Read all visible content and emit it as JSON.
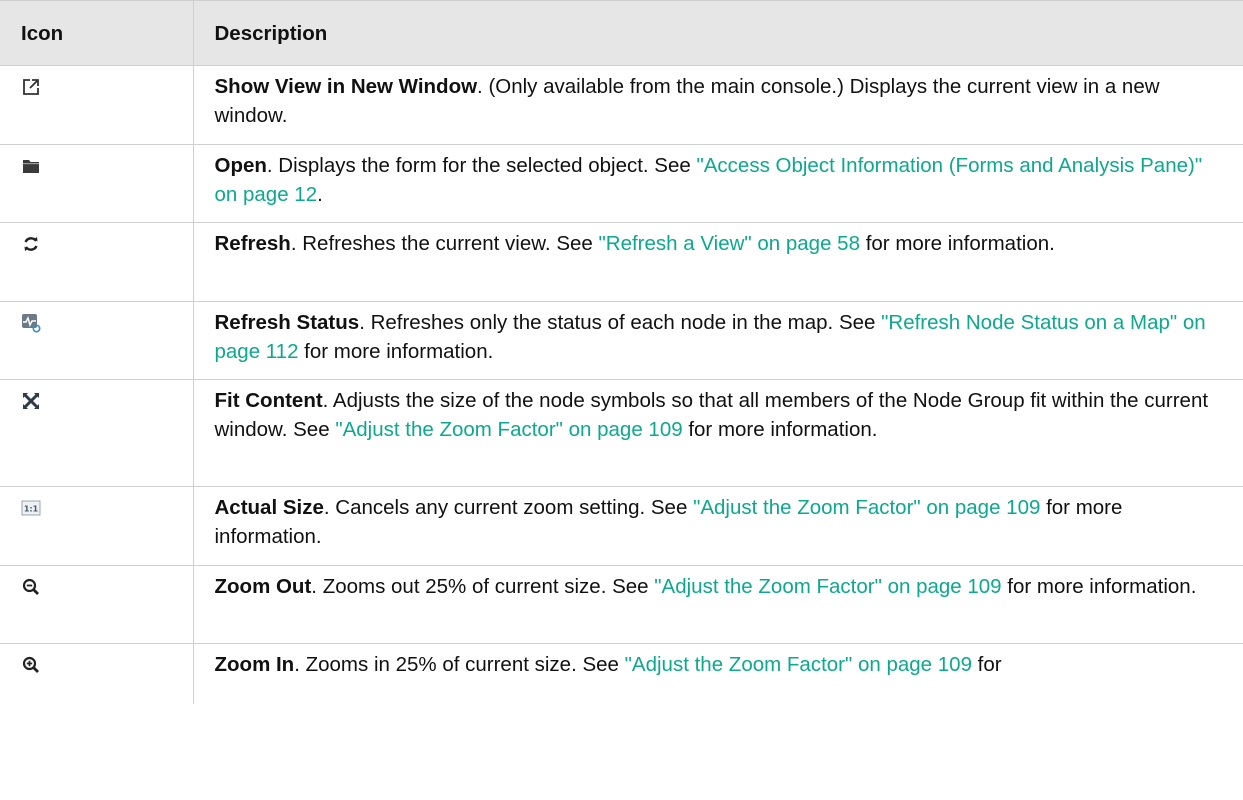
{
  "header": {
    "icon": "Icon",
    "description": "Description"
  },
  "rows": [
    {
      "icon": "new-window-icon",
      "title": "Show View in New Window",
      "pre": ". (Only available from the main console.) Displays the current view in a new window.",
      "link": "",
      "post": ""
    },
    {
      "icon": "folder-icon",
      "title": "Open",
      "pre": ". Displays the form for the selected object. See ",
      "link": "\"Access Object Information (Forms and Analysis Pane)\" on page 12",
      "post": "."
    },
    {
      "icon": "refresh-icon",
      "title": "Refresh",
      "pre": ". Refreshes the current view. See ",
      "link": "\"Refresh a View\" on page 58",
      "post": " for more information."
    },
    {
      "icon": "refresh-status-icon",
      "title": "Refresh Status",
      "pre": ". Refreshes only the status of each node in the map. See ",
      "link": "\"Refresh Node Status on a Map\" on page 112",
      "post": " for more information."
    },
    {
      "icon": "fit-content-icon",
      "title": "Fit Content",
      "pre": ". Adjusts the size of the node symbols so that all members of the Node Group fit within the current window. See ",
      "link": "\"Adjust the Zoom Factor\" on page 109",
      "post": " for more information."
    },
    {
      "icon": "actual-size-icon",
      "icon_text": "1:1",
      "title": "Actual Size",
      "pre": ". Cancels any current zoom setting. See ",
      "link": "\"Adjust the Zoom Factor\" on page 109",
      "post": " for more information."
    },
    {
      "icon": "zoom-out-icon",
      "title": "Zoom Out",
      "pre": ". Zooms out 25% of current size. See ",
      "link": "\"Adjust the Zoom Factor\" on page 109",
      "post": " for more information."
    },
    {
      "icon": "zoom-in-icon",
      "title": "Zoom In",
      "pre": ". Zooms in 25% of current size. See ",
      "link": "\"Adjust the Zoom Factor\" on page 109",
      "post": " for"
    }
  ],
  "colors": {
    "link": "#0ea88d",
    "header_bg": "#e6e6e6",
    "border": "#cfcfcf"
  }
}
